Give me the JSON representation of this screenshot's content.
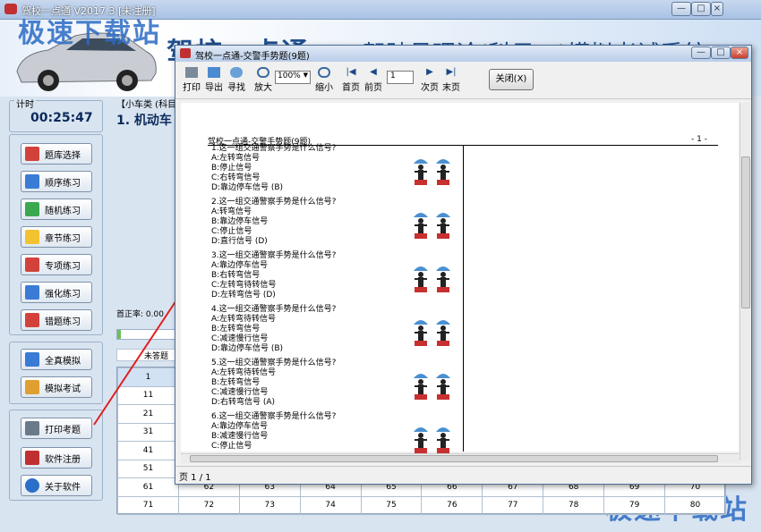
{
  "main": {
    "title": "驾校一点通 V2017.3 [未注册]",
    "banner_title": "驾校一点通",
    "banner_subtitle": "驾驶员理论(科目一)模拟考试系统",
    "timer_label": "计时",
    "timer_value": "00:25:47",
    "category_label": "【小车类 (科目一",
    "question_text": "1. 机动车",
    "accuracy_label": "首正率: 0.00",
    "unanswered_label": "未答题"
  },
  "watermark": "极速下载站",
  "sidebar": {
    "group1": [
      {
        "label": "题库选择",
        "icon": "cubes-icon",
        "color": "#d2423b"
      },
      {
        "label": "顺序练习",
        "icon": "pencil-list-icon",
        "color": "#3a7bd5"
      },
      {
        "label": "随机练习",
        "icon": "shuffle-icon",
        "color": "#3aa84f"
      },
      {
        "label": "章节练习",
        "icon": "folder-icon",
        "color": "#f2c230"
      },
      {
        "label": "专项练习",
        "icon": "checklist-icon",
        "color": "#d2423b"
      },
      {
        "label": "强化练习",
        "icon": "bar-chart-icon",
        "color": "#3a7bd5"
      },
      {
        "label": "错题练习",
        "icon": "flag-icon",
        "color": "#d2423b"
      }
    ],
    "group2": [
      {
        "label": "全真模拟",
        "icon": "calendar-icon",
        "color": "#3a7bd5"
      },
      {
        "label": "模拟考试",
        "icon": "grid-calendar-icon",
        "color": "#e0a030"
      }
    ],
    "group3": [
      {
        "label": "打印考题",
        "icon": "printer-icon",
        "color": "#6a7a8a"
      },
      {
        "label": "软件注册",
        "icon": "key-icon",
        "color": "#c03030"
      },
      {
        "label": "关于软件",
        "icon": "info-icon",
        "color": "#2a6fc9"
      }
    ]
  },
  "grid": {
    "rows": [
      [
        "1",
        "",
        "",
        "",
        "",
        "",
        "",
        "",
        "",
        ""
      ],
      [
        "11",
        "",
        "",
        "",
        "",
        "",
        "",
        "",
        "",
        ""
      ],
      [
        "21",
        "",
        "",
        "",
        "",
        "",
        "",
        "",
        "",
        ""
      ],
      [
        "31",
        "",
        "",
        "",
        "",
        "",
        "",
        "",
        "",
        ""
      ],
      [
        "41",
        "",
        "",
        "",
        "",
        "",
        "",
        "",
        "",
        ""
      ],
      [
        "51",
        "",
        "",
        "",
        "",
        "",
        "",
        "",
        "",
        ""
      ],
      [
        "61",
        "62",
        "63",
        "64",
        "65",
        "66",
        "67",
        "68",
        "69",
        "70"
      ],
      [
        "71",
        "72",
        "73",
        "74",
        "75",
        "76",
        "77",
        "78",
        "79",
        "80"
      ]
    ]
  },
  "dialog": {
    "title": "驾校一点通-交警手势题(9题)",
    "toolbar": {
      "print": "打印",
      "export": "导出",
      "find": "寻找",
      "zoom_in": "放大",
      "zoom_value": "100%",
      "zoom_out": "缩小",
      "first": "首页",
      "prev": "前页",
      "page_value": "1",
      "next": "次页",
      "last": "末页",
      "close": "关闭(X)"
    },
    "status": "页 1 / 1",
    "paper": {
      "header": "驾校一点通-交警手势题(9题)",
      "page_no": "- 1 -",
      "questions": [
        {
          "lines": [
            "1.这一组交通警察手势是什么信号?",
            "A:左转弯信号",
            "B:停止信号",
            "C:右转弯信号",
            "D:靠边停车信号 (B)"
          ]
        },
        {
          "lines": [
            "2.这一组交通警察手势是什么信号?",
            "A:转弯信号",
            "B:靠边停车信号",
            "C:停止信号",
            "D:直行信号 (D)"
          ]
        },
        {
          "lines": [
            "3.这一组交通警察手势是什么信号?",
            "A:靠边停车信号",
            "B:右转弯信号",
            "C:左转弯待转信号",
            "D:左转弯信号 (D)"
          ]
        },
        {
          "lines": [
            "4.这一组交通警察手势是什么信号?",
            "A:左转弯待转信号",
            "B:左转弯信号",
            "C:减速慢行信号",
            "D:靠边停车信号 (B)"
          ]
        },
        {
          "lines": [
            "5.这一组交通警察手势是什么信号?",
            "A:左转弯待转信号",
            "B:左转弯信号",
            "C:减速慢行信号",
            "D:右转弯信号 (A)"
          ]
        },
        {
          "lines": [
            "6.这一组交通警察手势是什么信号?",
            "A:靠边停车信号",
            "B:减速慢行信号",
            "C:停止信号"
          ]
        }
      ]
    }
  }
}
